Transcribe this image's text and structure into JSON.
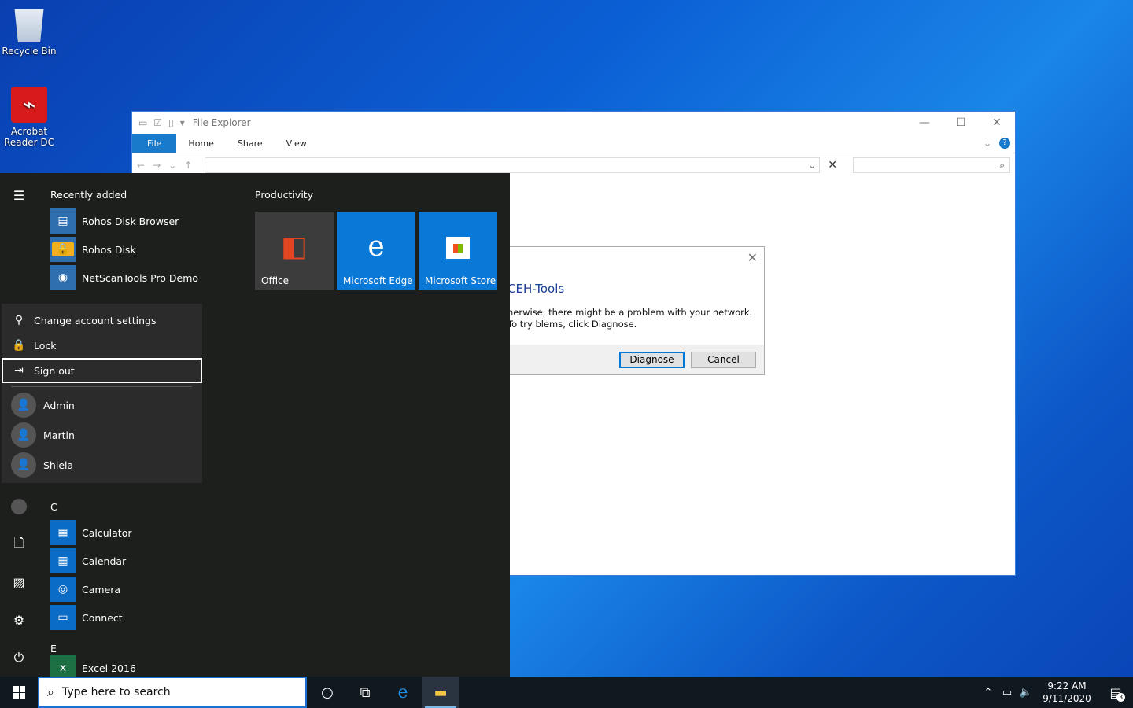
{
  "desktop": {
    "icons": [
      {
        "label": "Recycle Bin"
      },
      {
        "label": "Acrobat Reader DC"
      }
    ]
  },
  "explorer": {
    "title": "File Explorer",
    "tabs": [
      "File",
      "Home",
      "Share",
      "View"
    ]
  },
  "network_dialog": {
    "title": "CEH-Tools",
    "message": "herwise, there might be a problem with your network. To try blems, click Diagnose.",
    "diagnose_label": "Diagnose",
    "cancel_label": "Cancel"
  },
  "start_menu": {
    "recently_added_header": "Recently added",
    "recent_apps": [
      "Rohos Disk Browser",
      "Rohos Disk",
      "NetScanTools Pro Demo"
    ],
    "section_c": "C",
    "c_apps": [
      "Calculator",
      "Calendar",
      "Camera",
      "Connect"
    ],
    "section_e": "E",
    "e_apps": [
      "Excel 2016"
    ],
    "tiles_group": "Productivity",
    "tiles": [
      {
        "label": "Office",
        "color": "#3c3c3c"
      },
      {
        "label": "Microsoft Edge",
        "color": "#0a78d7"
      },
      {
        "label": "Microsoft Store",
        "color": "#0a78d7"
      }
    ],
    "account_menu": {
      "change_settings": "Change account settings",
      "lock": "Lock",
      "sign_out": "Sign out",
      "users": [
        "Admin",
        "Martin",
        "Shiela"
      ]
    }
  },
  "taskbar": {
    "search_placeholder": "Type here to search",
    "time": "9:22 AM",
    "date": "9/11/2020",
    "notification_count": "3"
  }
}
